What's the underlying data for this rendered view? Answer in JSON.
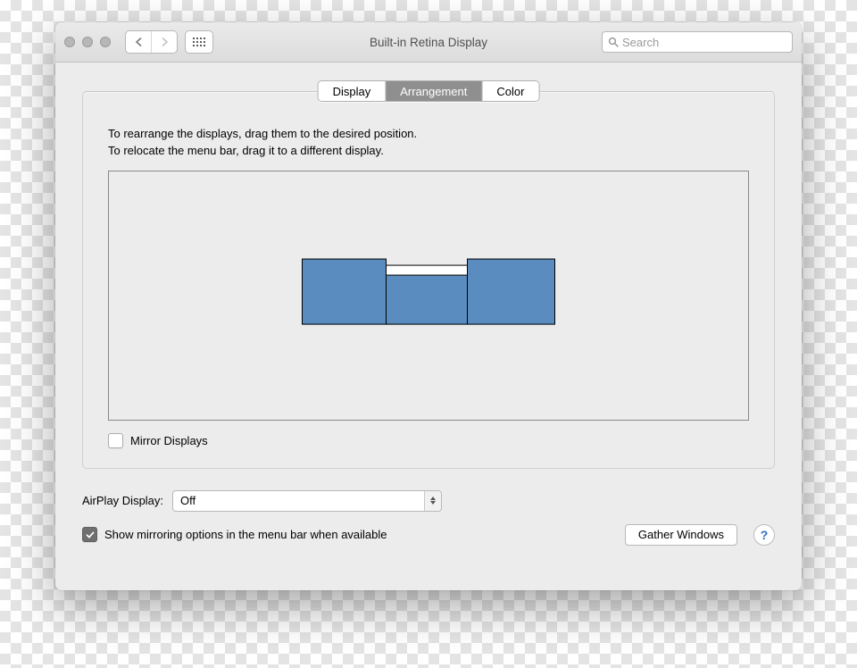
{
  "window": {
    "title": "Built-in Retina Display"
  },
  "search": {
    "placeholder": "Search",
    "value": ""
  },
  "tabs": {
    "items": [
      "Display",
      "Arrangement",
      "Color"
    ],
    "active_index": 1
  },
  "instructions": {
    "line1": "To rearrange the displays, drag them to the desired position.",
    "line2": "To relocate the menu bar, drag it to a different display."
  },
  "mirror": {
    "label": "Mirror Displays",
    "checked": false
  },
  "airplay": {
    "label": "AirPlay Display:",
    "value": "Off"
  },
  "show_mirroring": {
    "label": "Show mirroring options in the menu bar when available",
    "checked": true
  },
  "buttons": {
    "gather": "Gather Windows"
  },
  "help": {
    "glyph": "?"
  }
}
